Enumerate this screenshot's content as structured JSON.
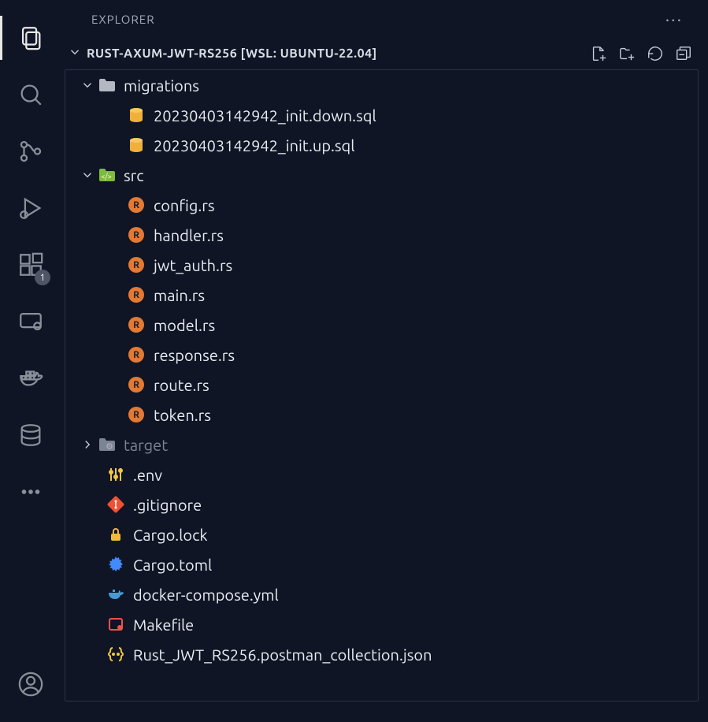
{
  "explorer": {
    "title": "EXPLORER"
  },
  "workspace": {
    "name": "RUST-AXUM-JWT-RS256 [WSL: UBUNTU-22.04]"
  },
  "activity": {
    "ext_badge": "1"
  },
  "tree": {
    "migrations": {
      "label": "migrations",
      "files": [
        "20230403142942_init.down.sql",
        "20230403142942_init.up.sql"
      ]
    },
    "src": {
      "label": "src",
      "files": [
        "config.rs",
        "handler.rs",
        "jwt_auth.rs",
        "main.rs",
        "model.rs",
        "response.rs",
        "route.rs",
        "token.rs"
      ]
    },
    "target": {
      "label": "target"
    },
    "root_files": {
      "env": ".env",
      "gitignore": ".gitignore",
      "cargolock": "Cargo.lock",
      "cargotoml": "Cargo.toml",
      "docker": "docker-compose.yml",
      "makefile": "Makefile",
      "postman": "Rust_JWT_RS256.postman_collection.json"
    }
  }
}
